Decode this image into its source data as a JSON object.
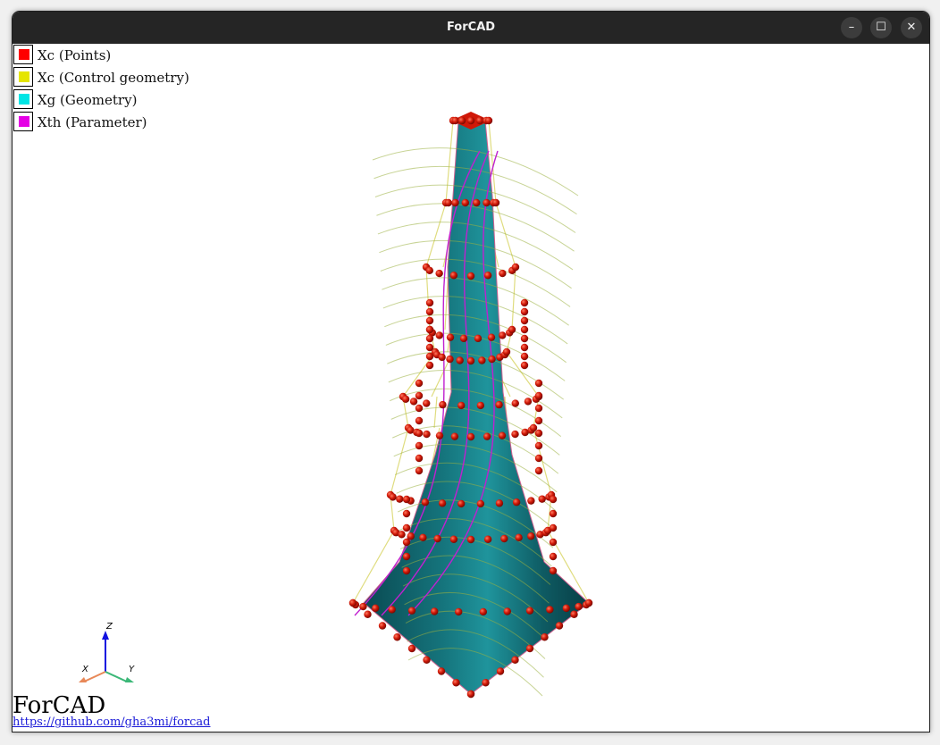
{
  "window": {
    "title": "ForCAD",
    "controls": {
      "minimize": "–",
      "maximize": "☐",
      "close": "✕"
    }
  },
  "legend": [
    {
      "label": "Xc (Points)",
      "color": "#ff0000"
    },
    {
      "label": "Xc (Control geometry)",
      "color": "#e5e500"
    },
    {
      "label": "Xg (Geometry)",
      "color": "#00e5e5"
    },
    {
      "label": "Xth (Parameter)",
      "color": "#e500e5"
    }
  ],
  "axes": {
    "x": "X",
    "y": "Y",
    "z": "Z"
  },
  "brand": {
    "name": "ForCAD",
    "url": "https://github.com/gha3mi/forcad"
  },
  "colors": {
    "surface": "#0e5a62",
    "surface_highlight": "#1f9aa3",
    "points": "#d01808",
    "control_lines": "#d8d460",
    "parameter_lines": "#c020d0"
  }
}
